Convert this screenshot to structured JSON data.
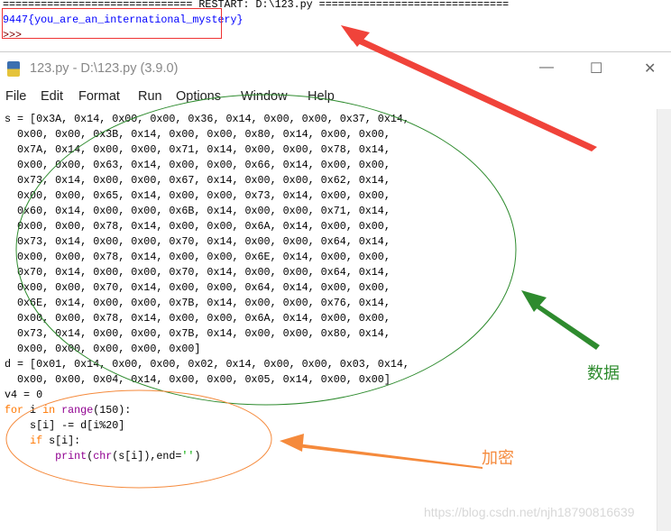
{
  "shell": {
    "restart_line": "============================== RESTART: D:\\123.py ==============================",
    "output": "9447{you_are_an_international_mystery}",
    "prompt": ">>>"
  },
  "window": {
    "title": "123.py - D:\\123.py (3.9.0)",
    "minimize": "—",
    "maximize": "☐",
    "close": "✕"
  },
  "menu": [
    "File",
    "Edit",
    "Format",
    "Run",
    "Options",
    "Window",
    "Help"
  ],
  "code": {
    "s_lines": [
      "s = [0x3A, 0x14, 0x00, 0x00, 0x36, 0x14, 0x00, 0x00, 0x37, 0x14,",
      "  0x00, 0x00, 0x3B, 0x14, 0x00, 0x00, 0x80, 0x14, 0x00, 0x00,",
      "  0x7A, 0x14, 0x00, 0x00, 0x71, 0x14, 0x00, 0x00, 0x78, 0x14,",
      "  0x00, 0x00, 0x63, 0x14, 0x00, 0x00, 0x66, 0x14, 0x00, 0x00,",
      "  0x73, 0x14, 0x00, 0x00, 0x67, 0x14, 0x00, 0x00, 0x62, 0x14,",
      "  0x00, 0x00, 0x65, 0x14, 0x00, 0x00, 0x73, 0x14, 0x00, 0x00,",
      "  0x60, 0x14, 0x00, 0x00, 0x6B, 0x14, 0x00, 0x00, 0x71, 0x14,",
      "  0x00, 0x00, 0x78, 0x14, 0x00, 0x00, 0x6A, 0x14, 0x00, 0x00,",
      "  0x73, 0x14, 0x00, 0x00, 0x70, 0x14, 0x00, 0x00, 0x64, 0x14,",
      "  0x00, 0x00, 0x78, 0x14, 0x00, 0x00, 0x6E, 0x14, 0x00, 0x00,",
      "  0x70, 0x14, 0x00, 0x00, 0x70, 0x14, 0x00, 0x00, 0x64, 0x14,",
      "  0x00, 0x00, 0x70, 0x14, 0x00, 0x00, 0x64, 0x14, 0x00, 0x00,",
      "  0x6E, 0x14, 0x00, 0x00, 0x7B, 0x14, 0x00, 0x00, 0x76, 0x14,",
      "  0x00, 0x00, 0x78, 0x14, 0x00, 0x00, 0x6A, 0x14, 0x00, 0x00,",
      "  0x73, 0x14, 0x00, 0x00, 0x7B, 0x14, 0x00, 0x00, 0x80, 0x14,",
      "  0x00, 0x00, 0x00, 0x00, 0x00]",
      "d = [0x01, 0x14, 0x00, 0x00, 0x02, 0x14, 0x00, 0x00, 0x03, 0x14,",
      "  0x00, 0x00, 0x04, 0x14, 0x00, 0x00, 0x05, 0x14, 0x00, 0x00]",
      "v4 = 0"
    ],
    "for_kw": "for",
    "for_mid": " i ",
    "in_kw": "in",
    "range_fn": "range",
    "for_end": "(150):",
    "sub_line": "    s[i] -= d[i%20]",
    "if_indent": "    ",
    "if_kw": "if",
    "if_rest": " s[i]:",
    "print_indent": "        ",
    "print_fn": "print",
    "paren": "(",
    "chr_fn": "chr",
    "print_mid": "(s[i]),end=",
    "str_lit": "''",
    "print_end": ")"
  },
  "annotations": {
    "data_label": "数据",
    "encrypt_label": "加密",
    "data_color": "#2e8b2e",
    "encrypt_color": "#f58a3c",
    "arrow_color": "#f0433a"
  },
  "watermark": "https://blog.csdn.net/njh18790816639"
}
